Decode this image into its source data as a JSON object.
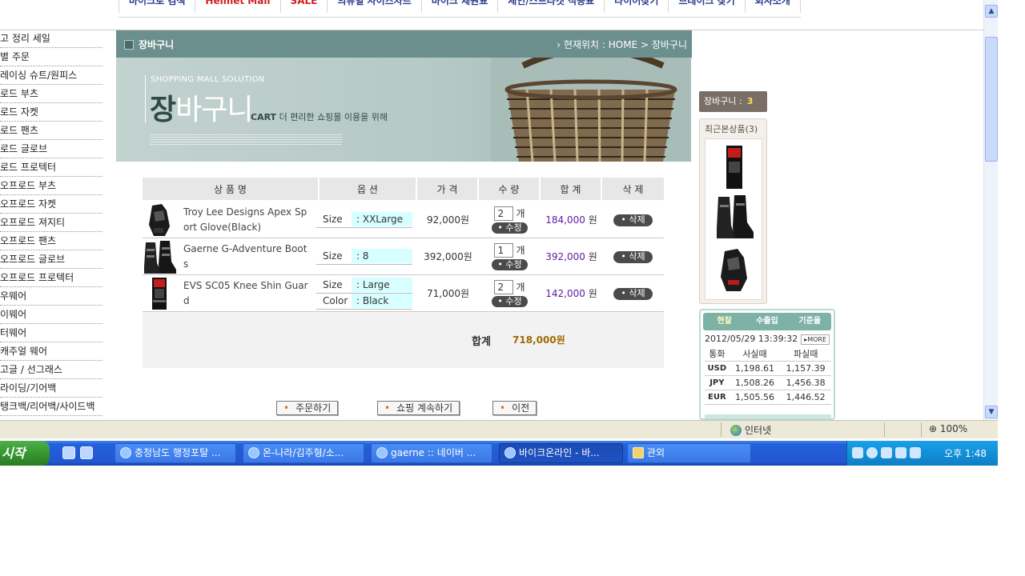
{
  "topnav": {
    "items": [
      {
        "label": "바이크로 검색",
        "red": false
      },
      {
        "label": "Helmet Mall",
        "red": true
      },
      {
        "label": "SALE",
        "red": true
      },
      {
        "label": "의류별 사이즈차트",
        "red": false
      },
      {
        "label": "바이크 제원표",
        "red": false
      },
      {
        "label": "체인/스프라켓 적용표",
        "red": false
      },
      {
        "label": "타이어찾기",
        "red": false
      },
      {
        "label": "브레이크 찾기",
        "red": false
      },
      {
        "label": "회사소개",
        "red": false
      }
    ]
  },
  "left_menu": {
    "items": [
      "고 정리 세일",
      "별 주문",
      "레이싱 슈트/원피스",
      "로드 부츠",
      "로드 자켓",
      "로드 팬츠",
      "로드 글로브",
      "로드 프로텍터",
      "오프로드 부츠",
      "오프로드 자켓",
      "오프로드 져지티",
      "오프로드 팬츠",
      "오프로드 글로브",
      "오프로드 프로텍터",
      "우웨어",
      "이웨어",
      "터웨어",
      "캐주얼 웨어",
      "고글 / 선그래스",
      "라이딩/기어백",
      "탱크백/리어백/사이드백"
    ]
  },
  "cart_header": {
    "title": "장바구니",
    "location": "› 현재위치 : HOME > 장바구니"
  },
  "banner": {
    "subtitle": "SHOPPING MALL SOLUTION",
    "title_strong": "장",
    "title_rest": "바구니",
    "tagline_strong": "CART",
    "tagline_rest": " 더 편리한 쇼핑몰 이용을 위해"
  },
  "cart_table": {
    "headers": [
      "상 품 명",
      "옵 션",
      "가 격",
      "수 량",
      "합 계",
      "삭 제"
    ],
    "unit": "개",
    "update_label": "• 수정",
    "delete_label": "• 삭제",
    "rows": [
      {
        "name": "Troy Lee Designs Apex Sport Glove(Black)",
        "options": [
          {
            "key": "Size",
            "value": ": XXLarge"
          }
        ],
        "price": "92,000원",
        "qty": "2",
        "total": "184,000",
        "total_unit": " 원"
      },
      {
        "name": "Gaerne G-Adventure Boots",
        "options": [
          {
            "key": "Size",
            "value": ": 8"
          }
        ],
        "price": "392,000원",
        "qty": "1",
        "total": "392,000",
        "total_unit": " 원"
      },
      {
        "name": "EVS SC05 Knee Shin Guard",
        "options": [
          {
            "key": "Size",
            "value": ": Large"
          },
          {
            "key": "Color",
            "value": ": Black"
          }
        ],
        "price": "71,000원",
        "qty": "2",
        "total": "142,000",
        "total_unit": " 원"
      }
    ],
    "total_label": "합계",
    "total_value": "718,000원"
  },
  "actions": {
    "order": "주문하기",
    "continue": "쇼핑 계속하기",
    "prev": "이전"
  },
  "sidebar": {
    "cart_label": "장바구니 :",
    "cart_count": "3",
    "recent_label": "최근본상품(3)"
  },
  "rates": {
    "tabs": [
      "현찰",
      "수출입",
      "기준율"
    ],
    "date": "2012/05/29 13:39:32",
    "more": "▸MORE",
    "headers": [
      "통화",
      "사실때",
      "파실때"
    ],
    "rows": [
      {
        "cur": "USD",
        "buy": "1,198.61",
        "sell": "1,157.39"
      },
      {
        "cur": "JPY",
        "buy": "1,508.26",
        "sell": "1,456.38"
      },
      {
        "cur": "EUR",
        "buy": "1,505.56",
        "sell": "1,446.52"
      }
    ]
  },
  "statusbar": {
    "zone": "인터넷",
    "zoom": "⊕ 100%"
  },
  "taskbar": {
    "start": "시작",
    "tasks": [
      {
        "label": "충청남도 행정포탈 ...",
        "active": false
      },
      {
        "label": "온-나라/김주형/소...",
        "active": false
      },
      {
        "label": "gaerne :: 네이버 ...",
        "active": false
      },
      {
        "label": "바이크온라인 - 바...",
        "active": true
      },
      {
        "label": "관외",
        "active": false
      }
    ],
    "clock": "오후 1:48"
  }
}
